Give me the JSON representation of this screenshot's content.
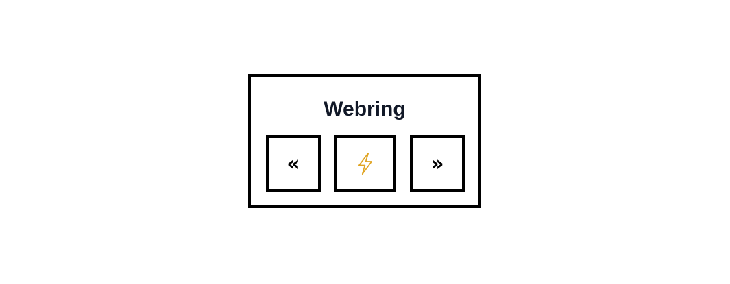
{
  "webring": {
    "title": "Webring",
    "prev": {
      "glyph": "«",
      "icon": "double-chevron-left-icon"
    },
    "random": {
      "icon": "lightning-bolt-icon",
      "color": "#e0a422"
    },
    "next": {
      "glyph": "»",
      "icon": "double-chevron-right-icon"
    }
  }
}
